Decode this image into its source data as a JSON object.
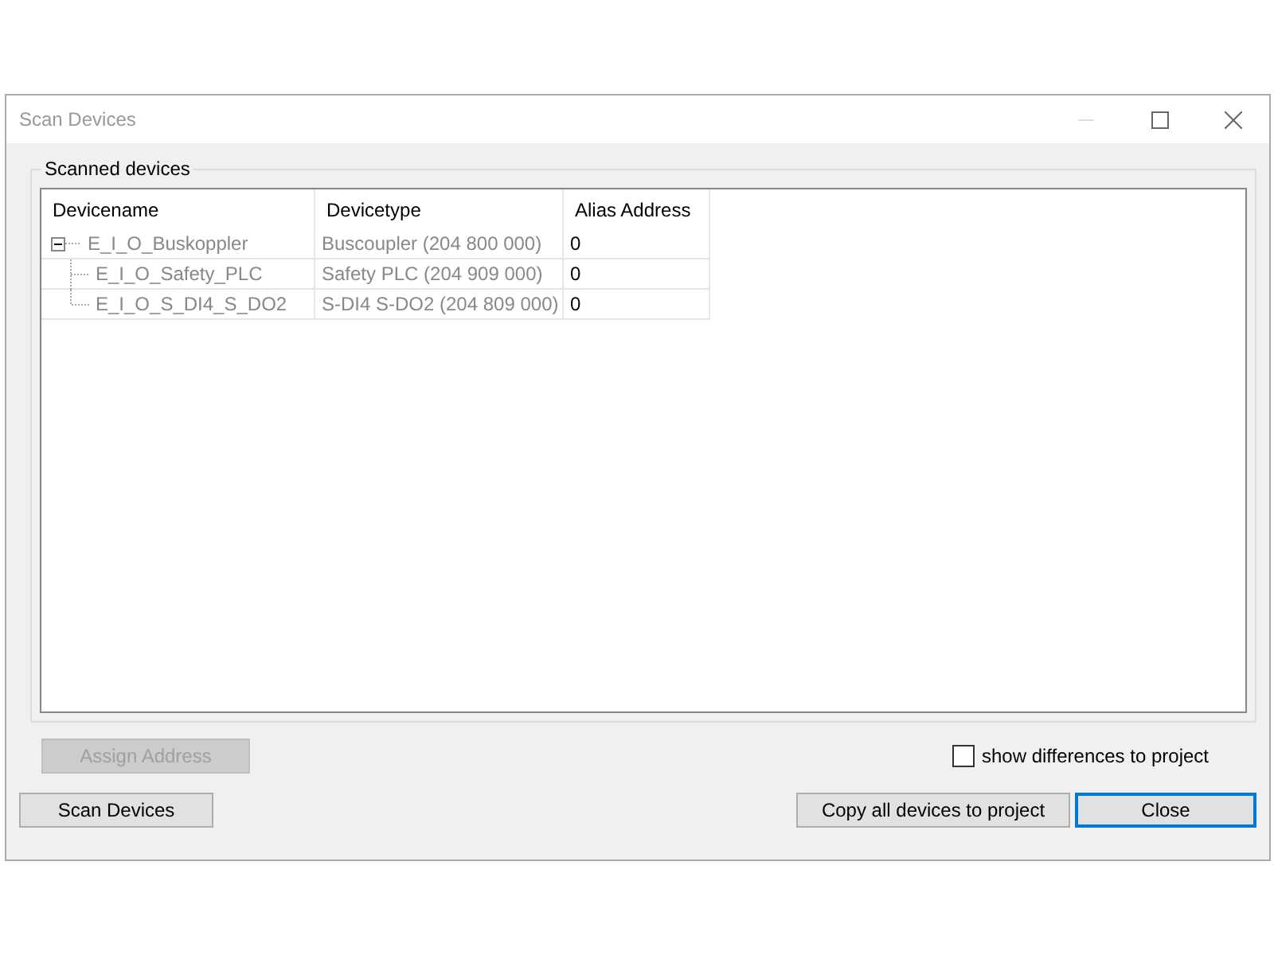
{
  "window": {
    "title": "Scan Devices"
  },
  "group": {
    "title": "Scanned devices"
  },
  "table": {
    "columns": [
      "Devicename",
      "Devicetype",
      "Alias Address"
    ],
    "rows": [
      {
        "name": "E_I_O_Buskoppler",
        "type": "Buscoupler (204 800 000)",
        "alias": "0",
        "expanded": true,
        "children": [
          {
            "name": "E_I_O_Safety_PLC",
            "type": "Safety PLC (204 909 000)",
            "alias": "0"
          },
          {
            "name": "E_I_O_S_DI4_S_DO2",
            "type": "S-DI4 S-DO2 (204 809 000)",
            "alias": "0"
          }
        ]
      }
    ]
  },
  "assign_button": {
    "label": "Assign Address",
    "disabled": true
  },
  "show_differences": {
    "label": "show differences to project",
    "checked": false
  },
  "buttons": [
    {
      "label": "Scan Devices",
      "default": false
    },
    {
      "label": "Copy all devices to project",
      "default": false
    },
    {
      "label": "Close",
      "default": true
    }
  ]
}
